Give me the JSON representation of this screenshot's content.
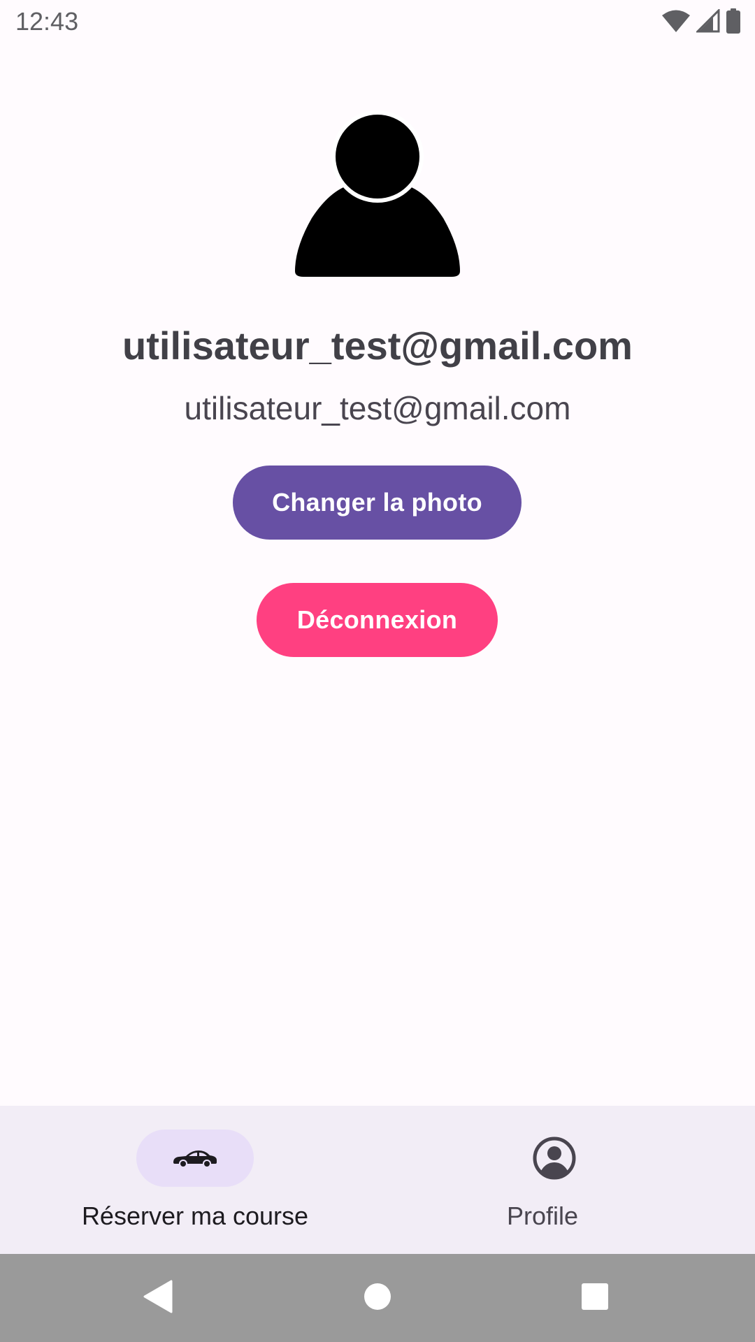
{
  "status_bar": {
    "time": "12:43",
    "icons": [
      "wifi-icon",
      "signal-icon",
      "battery-icon"
    ]
  },
  "profile": {
    "avatar_icon": "person-icon",
    "name": "utilisateur_test@gmail.com",
    "email": "utilisateur_test@gmail.com",
    "change_photo_label": "Changer la photo",
    "logout_label": "Déconnexion"
  },
  "bottom_nav": {
    "items": [
      {
        "label": "Réserver ma course",
        "icon": "car-icon",
        "selected": true
      },
      {
        "label": "Profile",
        "icon": "account-circle-icon",
        "selected": false
      }
    ]
  },
  "system_nav": {
    "buttons": [
      "back-icon",
      "home-icon",
      "recents-icon"
    ]
  },
  "colors": {
    "background": "#fffbfe",
    "primary": "#6750a4",
    "accent": "#ff4081",
    "nav_background": "#f2edf6",
    "nav_indicator": "#e8def8",
    "system_nav": "#9a9a9a"
  }
}
